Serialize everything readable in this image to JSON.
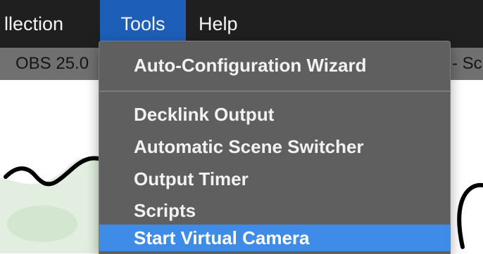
{
  "menubar": {
    "items": [
      "llection",
      "Tools",
      "Help"
    ]
  },
  "titlebar": {
    "left_text": "OBS 25.0",
    "right_text": "- Sc"
  },
  "tools_menu": {
    "items": [
      "Auto-Configuration Wizard",
      "Decklink Output",
      "Automatic Scene Switcher",
      "Output Timer",
      "Scripts",
      "Start Virtual Camera"
    ],
    "highlighted": "Start Virtual Camera"
  },
  "colors": {
    "menubar_bg": "#1f1f1f",
    "tools_highlight": "#1d5fb8",
    "menu_bg": "#5f5f5f",
    "item_highlight": "#3f8be8"
  }
}
